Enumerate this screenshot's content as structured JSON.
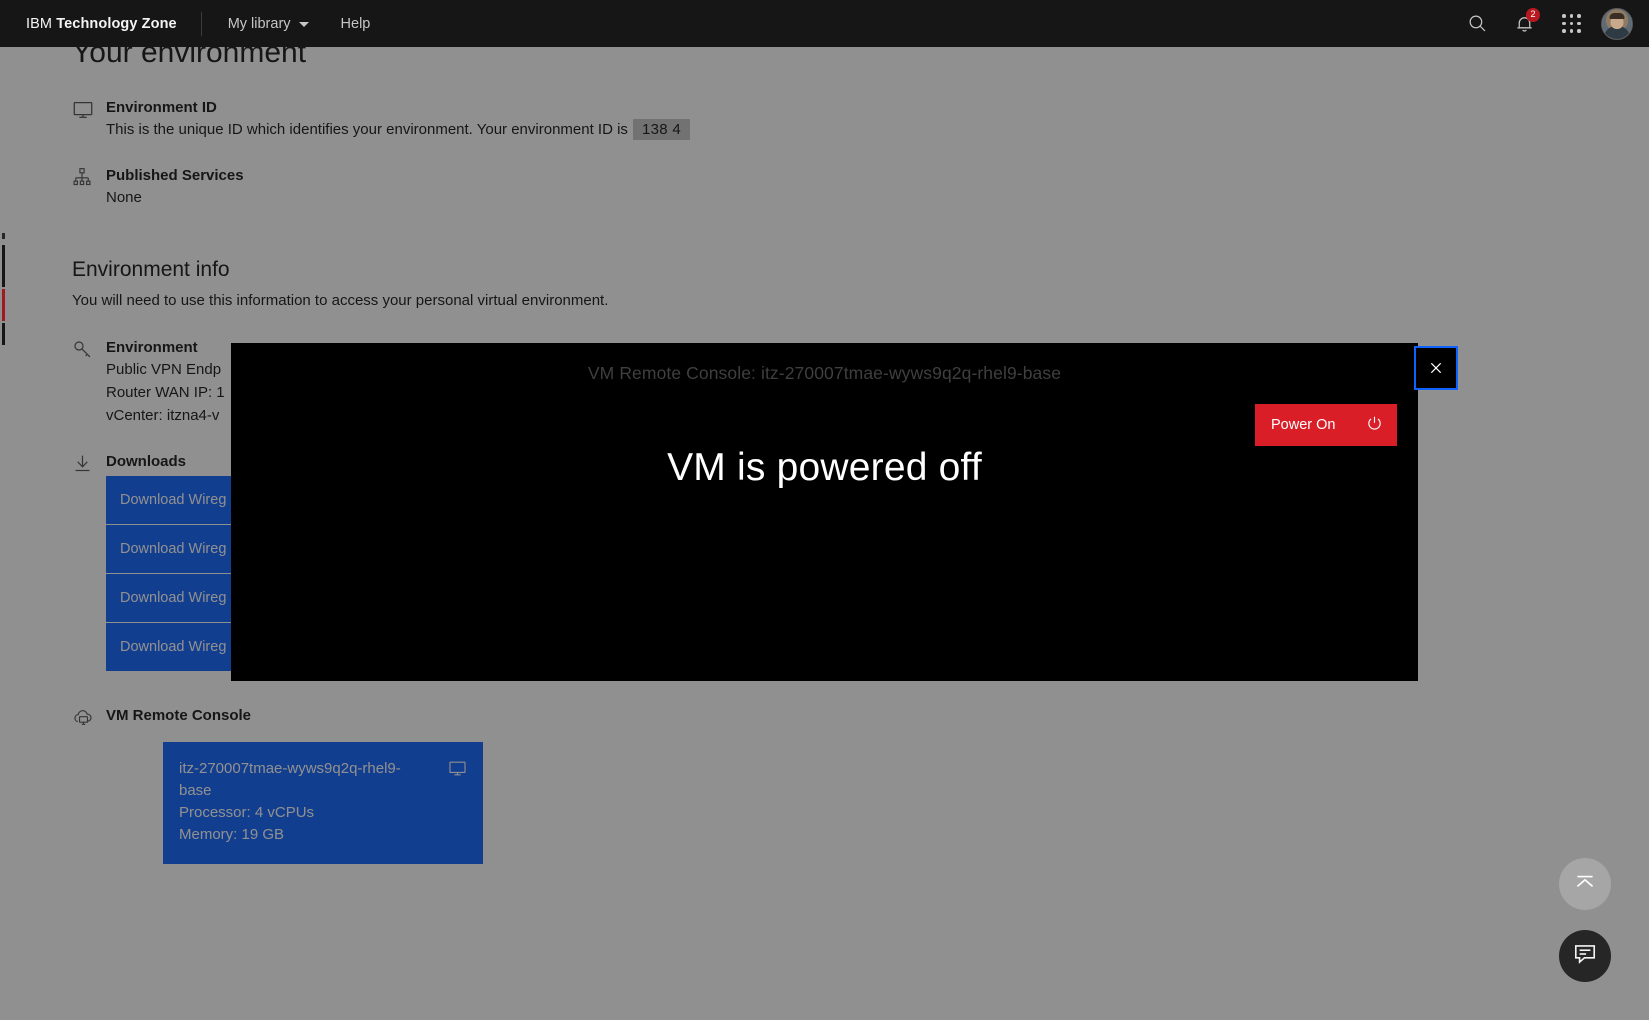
{
  "header": {
    "brand_prefix": "IBM",
    "brand_name": "Technology Zone",
    "nav": [
      {
        "label": "My library",
        "icon": "chevron-down-icon"
      },
      {
        "label": "Help",
        "icon": ""
      }
    ],
    "search_icon": "search-icon",
    "notifications_icon": "bell-icon",
    "notifications_count": "2",
    "app_switcher_icon": "grid-icon",
    "avatar": "user-avatar"
  },
  "page": {
    "title": "Your environment",
    "environment_id": {
      "icon": "monitor-icon",
      "label": "Environment ID",
      "text": "This is the unique ID which identifies your environment. Your environment ID is",
      "value": "138 4"
    },
    "published_services": {
      "icon": "sitemap-icon",
      "label": "Published Services",
      "value": "None"
    },
    "env_info": {
      "title": "Environment info",
      "subtitle": "You will need to use this information to access your personal virtual environment.",
      "environment": {
        "icon": "key-icon",
        "label": "Environment",
        "lines": [
          "Public VPN Endp",
          "Router WAN IP: 1",
          "vCenter: itzna4-v"
        ]
      }
    },
    "downloads": {
      "icon": "download-icon",
      "label": "Downloads",
      "buttons": [
        "Download Wireg",
        "Download Wireg",
        "Download Wireg",
        "Download Wireg"
      ]
    },
    "vm_remote_console": {
      "icon": "cloud-monitor-icon",
      "label": "VM Remote Console",
      "card": {
        "name": "itz-270007tmae-wyws9q2q-rhel9-base",
        "processor": "Processor: 4 vCPUs",
        "memory": "Memory: 19 GB",
        "icon": "monitor-icon"
      }
    }
  },
  "console_modal": {
    "title": "VM Remote Console: itz-270007tmae-wyws9q2q-rhel9-base",
    "status_message": "VM is powered off",
    "power_button": {
      "label": "Power On",
      "icon": "power-icon",
      "color": "#da1e28"
    },
    "close_button": {
      "icon": "close-icon",
      "outline_color": "#0f62fe"
    }
  },
  "floating": {
    "scroll_top": {
      "icon": "chevron-up-bar-icon"
    },
    "chat": {
      "icon": "chat-bubble-icon"
    }
  },
  "colors": {
    "header_bg": "#161616",
    "accent_blue": "#0f62fe",
    "danger_red": "#da1e28",
    "badge_red": "#b81921"
  }
}
